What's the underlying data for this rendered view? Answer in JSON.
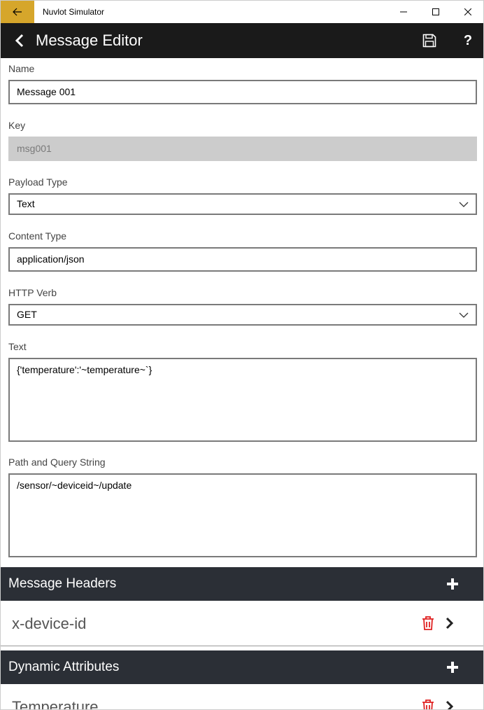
{
  "window": {
    "title": "Nuvlot Simulator",
    "accent_color": "#d6a62b"
  },
  "header": {
    "title": "Message Editor",
    "back_icon": "chevron-left-icon",
    "save_icon": "save-disk-icon",
    "help_label": "?"
  },
  "form": {
    "name": {
      "label": "Name",
      "value": "Message 001"
    },
    "key": {
      "label": "Key",
      "value": "msg001"
    },
    "payload_type": {
      "label": "Payload Type",
      "value": "Text"
    },
    "content_type": {
      "label": "Content Type",
      "value": "application/json"
    },
    "http_verb": {
      "label": "HTTP Verb",
      "value": "GET"
    },
    "text": {
      "label": "Text",
      "value": "{'temperature':'~temperature~`}"
    },
    "path": {
      "label": "Path and Query String",
      "value": "/sensor/~deviceid~/update"
    }
  },
  "message_headers": {
    "title": "Message Headers",
    "items": [
      {
        "label": "x-device-id"
      }
    ]
  },
  "dynamic_attributes": {
    "title": "Dynamic Attributes",
    "items": [
      {
        "label": "Temperature"
      }
    ]
  },
  "colors": {
    "header_bg": "#1a1a1a",
    "section_bg": "#2b2f36",
    "delete": "#e02020"
  }
}
